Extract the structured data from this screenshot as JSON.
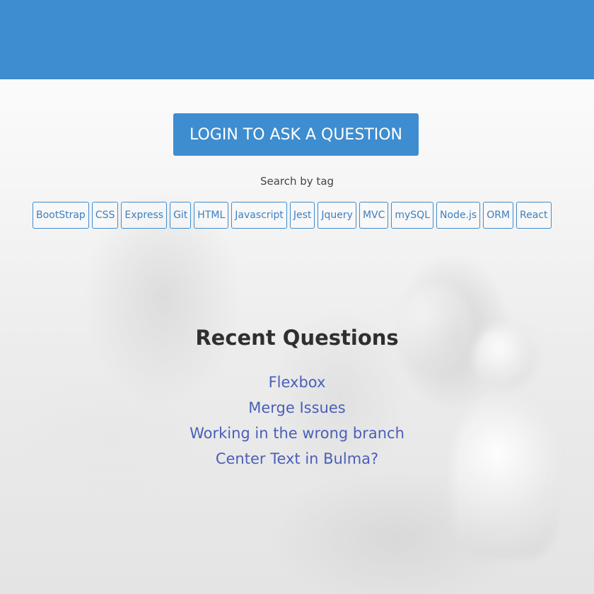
{
  "header": {
    "color": "#3d8dd0"
  },
  "login_button": {
    "label": "LOGIN TO ASK A QUESTION"
  },
  "search": {
    "label": "Search by tag"
  },
  "tags": [
    "BootStrap",
    "CSS",
    "Express",
    "Git",
    "HTML",
    "Javascript",
    "Jest",
    "Jquery",
    "MVC",
    "mySQL",
    "Node.js",
    "ORM",
    "React"
  ],
  "recent": {
    "title": "Recent Questions",
    "questions": [
      "Flexbox",
      "Merge Issues",
      "Working in the wrong branch",
      "Center Text in Bulma?"
    ]
  },
  "colors": {
    "accent": "#3d8dd0",
    "link": "#4a5fb8",
    "heading": "#2f2f2f"
  }
}
